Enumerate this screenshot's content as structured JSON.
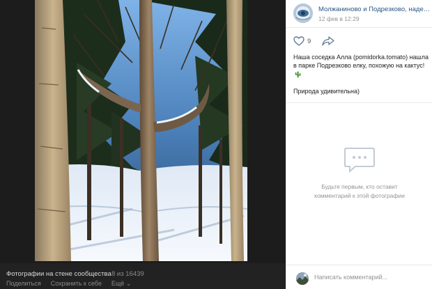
{
  "viewer": {
    "album_title": "Фотографии на стене сообщества",
    "counter": "8 из 16439",
    "actions": {
      "share": "Поделиться",
      "save": "Сохранить к себе",
      "more": "Ещё ⌄"
    }
  },
  "post": {
    "group_name": "Молжаниново и Подрезково, наде…",
    "date": "12 фев в 12:29",
    "likes": "9",
    "text_line1": "Наша соседка Алла (pomidorka.tomato) нашла в парке Подрезково елку, похожую на кактус!",
    "text_line2": "Природа удивительна)"
  },
  "comments": {
    "empty_line1": "Будьте первым, кто оставит",
    "empty_line2": "комментарий к этой фотографии",
    "input_placeholder": "Написать комментарий..."
  },
  "icons": {
    "like": "heart-icon",
    "share": "share-arrow-icon",
    "empty_comments": "speech-bubble-icon",
    "emoji": "cactus-emoji-icon"
  },
  "colors": {
    "link": "#2a5885",
    "muted": "#939393",
    "viewer_bg": "#1f1f1f"
  }
}
